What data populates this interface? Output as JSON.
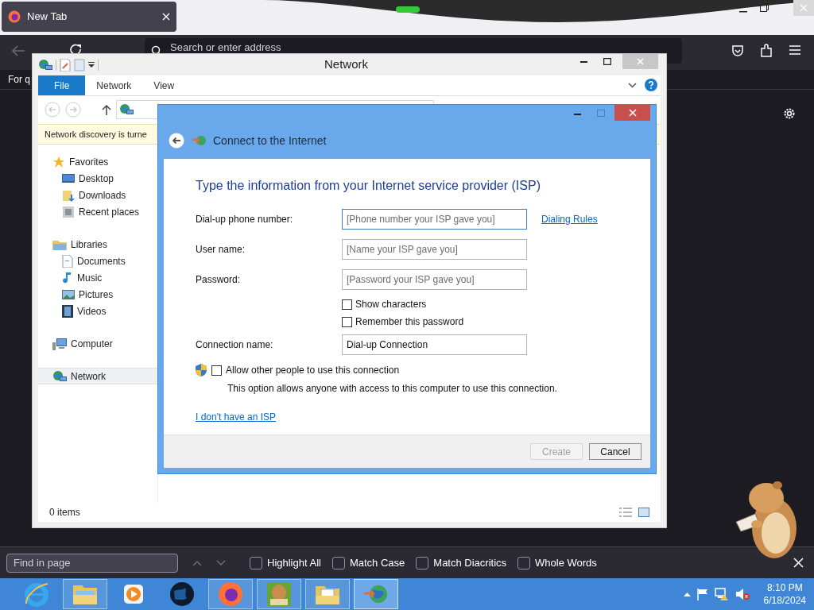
{
  "browser": {
    "tab": {
      "title": "New Tab",
      "selected": true
    },
    "address_placeholder": "Search or enter address",
    "shortcut_text": "For q"
  },
  "explorer": {
    "title": "Network",
    "ribbon_tabs": [
      {
        "label": "File",
        "selected": true
      },
      {
        "label": "Network",
        "selected": false
      },
      {
        "label": "View",
        "selected": false
      }
    ],
    "notice": "Network discovery is turne",
    "nav": [
      {
        "label": "Favorites",
        "kind": "star",
        "selected": false,
        "children": [
          {
            "label": "Desktop",
            "kind": "desktop",
            "selected": false
          },
          {
            "label": "Downloads",
            "kind": "downloads",
            "selected": false
          },
          {
            "label": "Recent places",
            "kind": "recent",
            "selected": false
          }
        ]
      },
      {
        "label": "Libraries",
        "kind": "libraries",
        "selected": false,
        "children": [
          {
            "label": "Documents",
            "kind": "documents",
            "selected": false
          },
          {
            "label": "Music",
            "kind": "music",
            "selected": false
          },
          {
            "label": "Pictures",
            "kind": "pictures",
            "selected": false
          },
          {
            "label": "Videos",
            "kind": "videos",
            "selected": false
          }
        ]
      },
      {
        "label": "Computer",
        "kind": "computer",
        "selected": false
      },
      {
        "label": "Network",
        "kind": "network",
        "selected": true
      }
    ],
    "status": "0 items"
  },
  "dialog": {
    "title": "Connect to the Internet",
    "heading": "Type the information from your Internet service provider (ISP)",
    "fields": [
      {
        "label": "Dial-up phone number:",
        "placeholder": "[Phone number your ISP gave you]",
        "focused": true
      },
      {
        "label": "User name:",
        "placeholder": "[Name your ISP gave you]",
        "focused": false
      },
      {
        "label": "Password:",
        "placeholder": "[Password your ISP gave you]",
        "focused": false
      }
    ],
    "dialing_rules_link": "Dialing Rules",
    "password_options": [
      {
        "label": "Show characters",
        "checked": false
      },
      {
        "label": "Remember this password",
        "checked": false
      }
    ],
    "connection_name": {
      "label": "Connection name:",
      "value": "Dial-up Connection"
    },
    "allow_others": {
      "label": "Allow other people to use this connection",
      "checked": false,
      "description": "This option allows anyone with access to this computer to use this connection."
    },
    "no_isp_link": "I don't have an ISP",
    "buttons": [
      {
        "label": "Create",
        "disabled": true
      },
      {
        "label": "Cancel",
        "disabled": false
      }
    ]
  },
  "find_bar": {
    "placeholder": "Find in page",
    "options": [
      {
        "label": "Highlight All",
        "checked": false
      },
      {
        "label": "Match Case",
        "checked": false
      },
      {
        "label": "Match Diacritics",
        "checked": false
      },
      {
        "label": "Whole Words",
        "checked": false
      }
    ]
  },
  "taskbar": {
    "apps": [
      {
        "kind": "ie",
        "running": false,
        "selected": false
      },
      {
        "kind": "folder",
        "running": true,
        "selected": false
      },
      {
        "kind": "media",
        "running": false,
        "selected": false
      },
      {
        "kind": "globe",
        "running": false,
        "selected": false
      },
      {
        "kind": "firefox",
        "running": true,
        "selected": false
      },
      {
        "kind": "hamster",
        "running": true,
        "selected": false
      },
      {
        "kind": "files",
        "running": true,
        "selected": false
      },
      {
        "kind": "network",
        "running": true,
        "selected": true
      }
    ],
    "time": "8:10 PM",
    "date": "6/18/2024"
  }
}
